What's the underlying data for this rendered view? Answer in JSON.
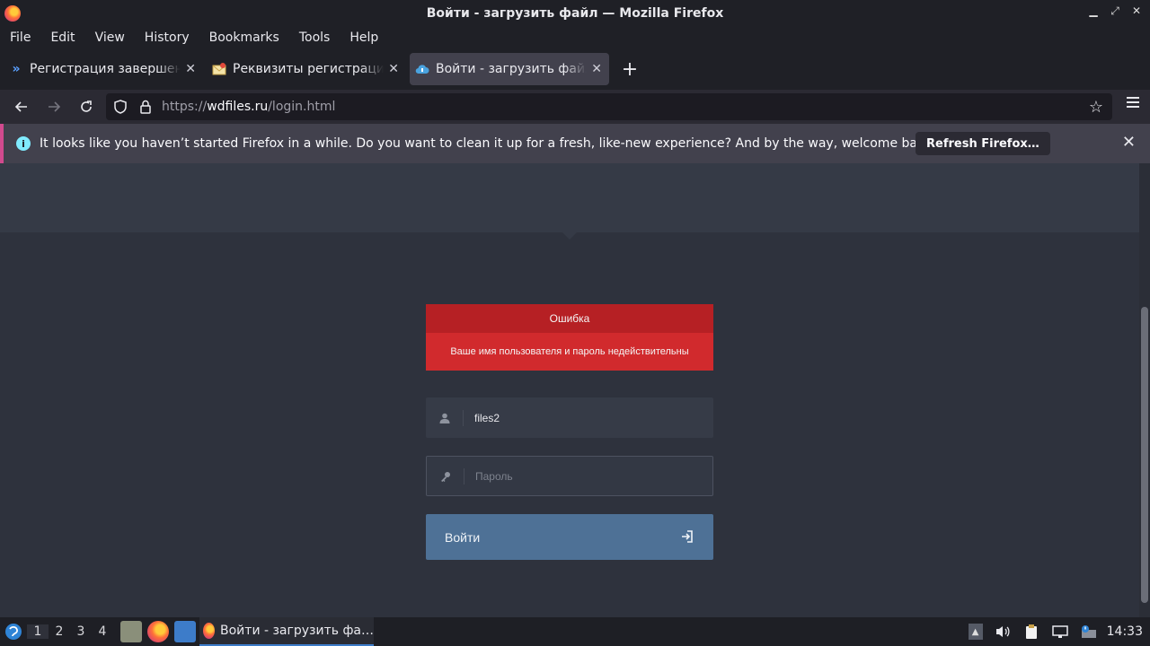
{
  "window": {
    "title": "Войти - загрузить файл — Mozilla Firefox"
  },
  "menubar": {
    "items": [
      "File",
      "Edit",
      "View",
      "History",
      "Bookmarks",
      "Tools",
      "Help"
    ]
  },
  "tabs": [
    {
      "title": "Регистрация завершена",
      "icon": "double-chevron-icon",
      "active": false
    },
    {
      "title": "Реквизиты регистрации",
      "icon": "envelope-icon",
      "active": false
    },
    {
      "title": "Войти - загрузить файл",
      "icon": "cloud-icon",
      "active": true
    }
  ],
  "urlbar": {
    "prefix": "https://",
    "host": "wdfiles.ru",
    "path": "/login.html"
  },
  "notification": {
    "message": "It looks like you haven’t started Firefox in a while. Do you want to clean it up for a fresh, like-new experience? And by the way, welcome back!",
    "button": "Refresh Firefox…"
  },
  "page": {
    "error_title": "Ошибка",
    "error_message": "Ваше имя пользователя и пароль недействительны",
    "username_value": "files2",
    "password_placeholder": "Пароль",
    "login_button": "Войти"
  },
  "taskbar": {
    "workspaces": [
      "1",
      "2",
      "3",
      "4"
    ],
    "active_workspace": "1",
    "window_title": "Войти - загрузить фа…",
    "clock": "14:33"
  },
  "colors": {
    "error_header": "#b62024",
    "error_body": "#d12a2d",
    "login_button": "#4e7196",
    "page_bg": "#2e323d"
  }
}
